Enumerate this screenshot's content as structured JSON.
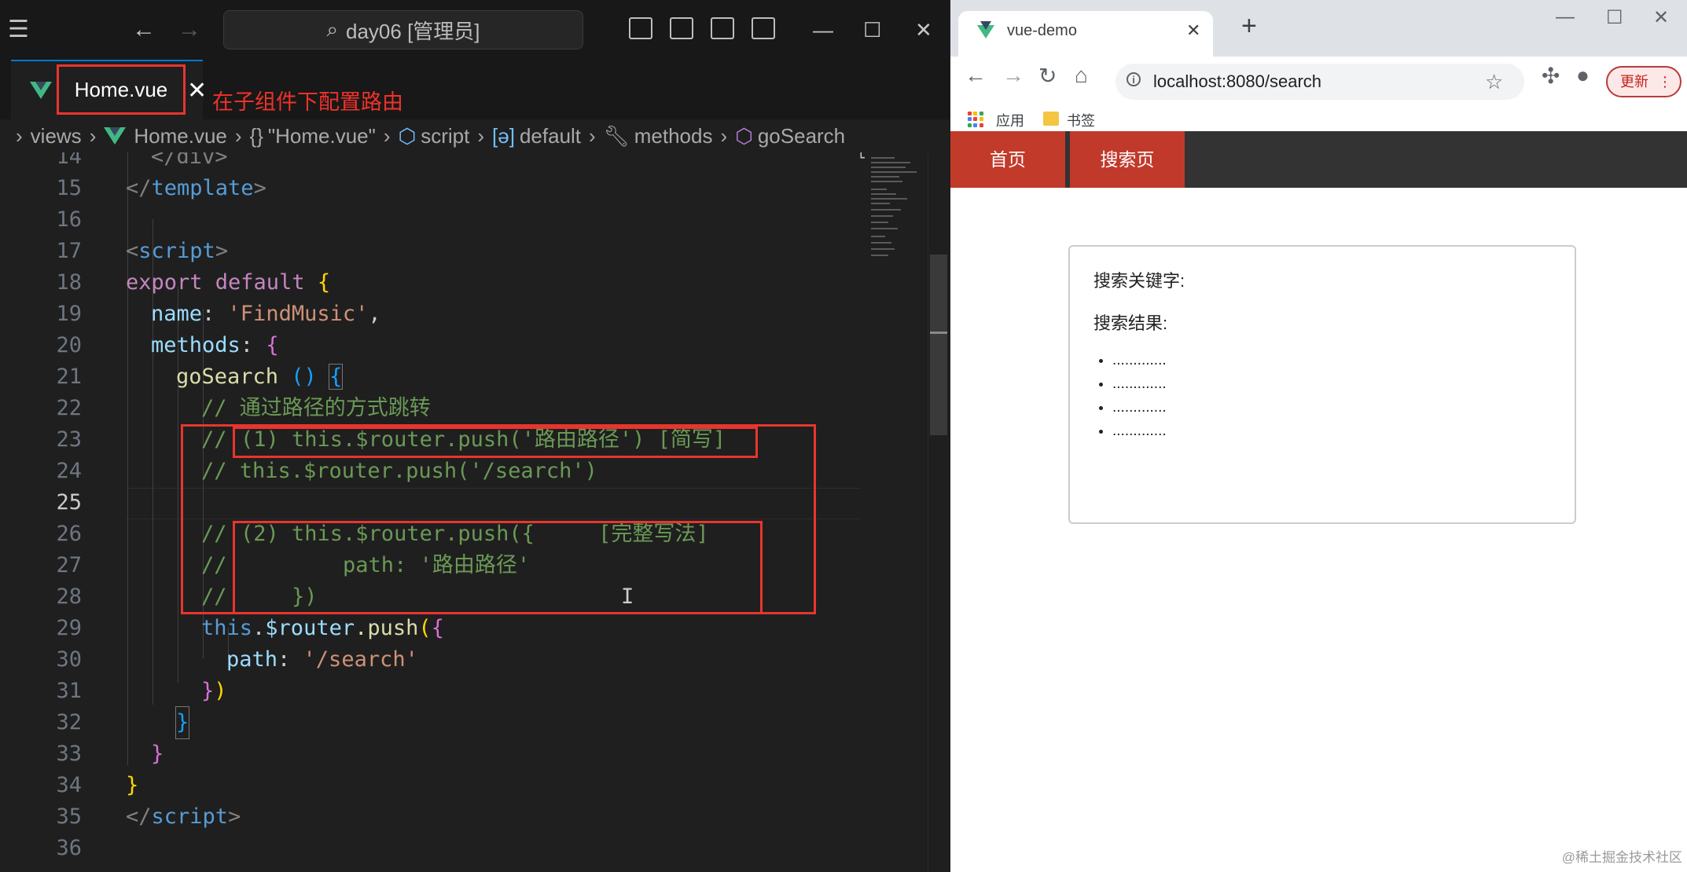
{
  "vscode": {
    "search_box": "day06 [管理员]",
    "tab": {
      "label": "Home.vue"
    },
    "annotation": "在子组件下配置路由",
    "breadcrumb": {
      "views": "views",
      "file": "Home.vue",
      "module": "\"Home.vue\"",
      "script": "script",
      "default": "default",
      "methods": "methods",
      "fn": "goSearch"
    },
    "line_numbers": [
      "14",
      "15",
      "16",
      "17",
      "18",
      "19",
      "20",
      "21",
      "22",
      "23",
      "24",
      "25",
      "26",
      "27",
      "28",
      "29",
      "30",
      "31",
      "32",
      "33",
      "34",
      "35",
      "36"
    ],
    "active_line": "25",
    "code": {
      "l14": "</div>",
      "l15_open": "</",
      "l15_tag": "template",
      "l15_close": ">",
      "l17_open": "<",
      "l17_tag": "script",
      "l17_close": ">",
      "l18_kw": "export default",
      "l18_brace": "{",
      "l19_prop": "name",
      "l19_colon": ": ",
      "l19_str": "'FindMusic'",
      "l19_comma": ",",
      "l20_prop": "methods",
      "l20_colon": ": ",
      "l20_brace": "{",
      "l21_fn": "goSearch",
      "l21_parens": " ()",
      "l21_brace": "{",
      "l22": "// 通过路径的方式跳转",
      "l23_slash": "//",
      "l23": "(1) this.$router.push('路由路径') [简写]",
      "l24": "// this.$router.push('/search')",
      "l26_slash": "//",
      "l26": "(2) this.$router.push({     [完整写法]",
      "l27_slash": "//",
      "l27": "        path: '路由路径'",
      "l28_slash": "//",
      "l28": "    })",
      "l29_this": "this",
      "l29_dot": ".",
      "l29_router": "$router",
      "l29_push": ".push",
      "l29_paren": "(",
      "l29_brace": "{",
      "l30_prop": "path",
      "l30_colon": ": ",
      "l30_str": "'/search'",
      "l31_brace": "}",
      "l31_paren": ")",
      "l32": "}",
      "l33": "}",
      "l34": "}",
      "l35_open": "</",
      "l35_tag": "script",
      "l35_close": ">"
    }
  },
  "chrome": {
    "tab_title": "vue-demo",
    "url": "localhost:8080/search",
    "update_button": "更新",
    "bookmarks": {
      "apps": "应用",
      "bookmarks": "书签"
    },
    "nav": {
      "home": "首页",
      "search": "搜索页"
    },
    "card": {
      "keyword_label": "搜索关键字:",
      "result_label": "搜索结果:",
      "results": [
        ".............",
        ".............",
        ".............",
        "............."
      ]
    }
  },
  "watermark": "@稀土掘金技术社区",
  "colors": {
    "vue_green": "#41b883",
    "annotation_red": "#e8352e",
    "nav_active": "#c0392b"
  }
}
